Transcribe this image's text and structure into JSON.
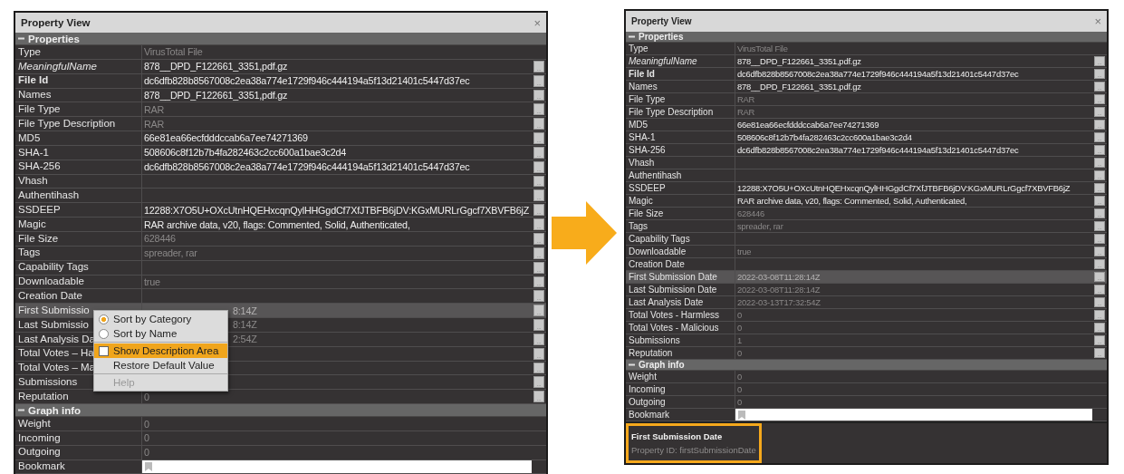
{
  "more_button": "...",
  "panels": [
    {
      "title": "Property View",
      "close": "×",
      "sections": [
        {
          "title": "Properties",
          "expanded": true,
          "rows": [
            {
              "label": "Type",
              "value": "VirusTotal File",
              "kind": "plain",
              "dim": true,
              "button": false,
              "selected": false
            },
            {
              "label": "MeaningfulName",
              "value": "878__DPD_F122661_3351,pdf.gz",
              "kind": "italic",
              "dim": false,
              "button": true,
              "selected": false
            },
            {
              "label": "File Id",
              "value": "dc6dfb828b8567008c2ea38a774e1729f946c444194a5f13d21401c5447d37ec",
              "kind": "bold",
              "dim": false,
              "button": true,
              "selected": false
            },
            {
              "label": "Names",
              "value": "878__DPD_F122661_3351,pdf.gz",
              "kind": "plain",
              "dim": false,
              "button": true,
              "selected": false
            },
            {
              "label": "File Type",
              "value": "RAR",
              "kind": "plain",
              "dim": true,
              "button": true,
              "selected": false
            },
            {
              "label": "File Type Description",
              "value": "RAR",
              "kind": "plain",
              "dim": true,
              "button": true,
              "selected": false
            },
            {
              "label": "MD5",
              "value": "66e81ea66ecfdddccab6a7ee74271369",
              "kind": "plain",
              "dim": false,
              "button": true,
              "selected": false
            },
            {
              "label": "SHA-1",
              "value": "508606c8f12b7b4fa282463c2cc600a1bae3c2d4",
              "kind": "plain",
              "dim": false,
              "button": true,
              "selected": false
            },
            {
              "label": "SHA-256",
              "value": "dc6dfb828b8567008c2ea38a774e1729f946c444194a5f13d21401c5447d37ec",
              "kind": "plain",
              "dim": false,
              "button": true,
              "selected": false
            },
            {
              "label": "Vhash",
              "kind": "plain",
              "button": true,
              "selected": false
            },
            {
              "label": "Authentihash",
              "kind": "plain",
              "button": true,
              "selected": false
            },
            {
              "label": "SSDEEP",
              "value": "12288:X7O5U+OXcUtnHQEHxcqnQylHHGgdCf7XfJTBFB6jDV:KGxMURLrGgcf7XBVFB6jZ",
              "kind": "plain",
              "dim": false,
              "button": true,
              "selected": false
            },
            {
              "label": "Magic",
              "value": "RAR archive data, v20, flags: Commented, Solid, Authenticated,",
              "kind": "plain",
              "dim": false,
              "button": true,
              "selected": false
            },
            {
              "label": "File Size",
              "value": "628446",
              "kind": "plain",
              "dim": true,
              "button": true,
              "selected": false
            },
            {
              "label": "Tags",
              "value": "spreader, rar",
              "kind": "plain",
              "dim": true,
              "button": true,
              "selected": false
            },
            {
              "label": "Capability Tags",
              "kind": "plain",
              "button": true,
              "selected": false
            },
            {
              "label": "Downloadable",
              "value": "true",
              "kind": "plain",
              "dim": true,
              "button": true,
              "selected": false
            },
            {
              "label": "Creation Date",
              "kind": "plain",
              "button": true,
              "selected": false
            },
            {
              "label": "First Submissio",
              "value": "8:14Z",
              "kind": "plain",
              "dim": true,
              "button": true,
              "selected": true,
              "covered": true
            },
            {
              "label": "Last Submissio",
              "value": "8:14Z",
              "kind": "plain",
              "dim": true,
              "button": true,
              "selected": false,
              "covered": true
            },
            {
              "label": "Last Analysis Da",
              "value": "2:54Z",
              "kind": "plain",
              "dim": true,
              "button": true,
              "selected": false,
              "covered": true
            },
            {
              "label": "Total Votes – Ha",
              "kind": "plain",
              "button": true,
              "selected": false
            },
            {
              "label": "Total Votes – Ma",
              "kind": "plain",
              "button": true,
              "selected": false
            },
            {
              "label": "Submissions",
              "kind": "plain",
              "button": true,
              "selected": false
            },
            {
              "label": "Reputation",
              "value": "0",
              "kind": "plain",
              "dim": true,
              "button": true,
              "selected": false
            }
          ]
        },
        {
          "title": "Graph info",
          "expanded": true,
          "rows": [
            {
              "label": "Weight",
              "value": "0",
              "kind": "plain",
              "dim": true,
              "button": false,
              "selected": false
            },
            {
              "label": "Incoming",
              "value": "0",
              "kind": "plain",
              "dim": true,
              "button": false,
              "selected": false
            },
            {
              "label": "Outgoing",
              "value": "0",
              "kind": "plain",
              "dim": true,
              "button": false,
              "selected": false
            },
            {
              "label": "Bookmark",
              "kind": "bookmark",
              "button": false,
              "selected": false
            }
          ]
        }
      ],
      "context_menu": {
        "items": [
          {
            "kind": "radio",
            "label": "Sort by Category",
            "checked": true,
            "highlighted": false,
            "disabled": false
          },
          {
            "kind": "radio",
            "label": "Sort by Name",
            "checked": false,
            "highlighted": false,
            "disabled": false
          },
          {
            "kind": "separator"
          },
          {
            "kind": "checkbox",
            "label": "Show Description Area",
            "checked": false,
            "highlighted": true,
            "disabled": false
          },
          {
            "kind": "plain",
            "label": "Restore Default Value",
            "highlighted": false,
            "disabled": false
          },
          {
            "kind": "separator"
          },
          {
            "kind": "plain",
            "label": "Help",
            "highlighted": false,
            "disabled": true
          }
        ]
      }
    },
    {
      "title": "Property View",
      "close": "×",
      "sections": [
        {
          "title": "Properties",
          "expanded": true,
          "rows": [
            {
              "label": "Type",
              "value": "VirusTotal File",
              "kind": "plain",
              "dim": true,
              "button": false,
              "selected": false
            },
            {
              "label": "MeaningfulName",
              "value": "878__DPD_F122661_3351,pdf.gz",
              "kind": "italic",
              "dim": false,
              "button": true,
              "selected": false
            },
            {
              "label": "File Id",
              "value": "dc6dfb828b8567008c2ea38a774e1729f946c444194a5f13d21401c5447d37ec",
              "kind": "bold",
              "dim": false,
              "button": true,
              "selected": false
            },
            {
              "label": "Names",
              "value": "878__DPD_F122661_3351,pdf.gz",
              "kind": "plain",
              "dim": false,
              "button": true,
              "selected": false
            },
            {
              "label": "File Type",
              "value": "RAR",
              "kind": "plain",
              "dim": true,
              "button": true,
              "selected": false
            },
            {
              "label": "File Type Description",
              "value": "RAR",
              "kind": "plain",
              "dim": true,
              "button": true,
              "selected": false
            },
            {
              "label": "MD5",
              "value": "66e81ea66ecfdddccab6a7ee74271369",
              "kind": "plain",
              "dim": false,
              "button": true,
              "selected": false
            },
            {
              "label": "SHA-1",
              "value": "508606c8f12b7b4fa282463c2cc600a1bae3c2d4",
              "kind": "plain",
              "dim": false,
              "button": true,
              "selected": false
            },
            {
              "label": "SHA-256",
              "value": "dc6dfb828b8567008c2ea38a774e1729f946c444194a5f13d21401c5447d37ec",
              "kind": "plain",
              "dim": false,
              "button": true,
              "selected": false
            },
            {
              "label": "Vhash",
              "kind": "plain",
              "button": true,
              "selected": false
            },
            {
              "label": "Authentihash",
              "kind": "plain",
              "button": true,
              "selected": false
            },
            {
              "label": "SSDEEP",
              "value": "12288:X7O5U+OXcUtnHQEHxcqnQylHHGgdCf7XfJTBFB6jDV:KGxMURLrGgcf7XBVFB6jZ",
              "kind": "plain",
              "dim": false,
              "button": true,
              "selected": false
            },
            {
              "label": "Magic",
              "value": "RAR archive data, v20, flags: Commented, Solid, Authenticated,",
              "kind": "plain",
              "dim": false,
              "button": true,
              "selected": false
            },
            {
              "label": "File Size",
              "value": "628446",
              "kind": "plain",
              "dim": true,
              "button": true,
              "selected": false
            },
            {
              "label": "Tags",
              "value": "spreader, rar",
              "kind": "plain",
              "dim": true,
              "button": true,
              "selected": false
            },
            {
              "label": "Capability Tags",
              "kind": "plain",
              "button": true,
              "selected": false
            },
            {
              "label": "Downloadable",
              "value": "true",
              "kind": "plain",
              "dim": true,
              "button": true,
              "selected": false
            },
            {
              "label": "Creation Date",
              "kind": "plain",
              "button": true,
              "selected": false
            },
            {
              "label": "First Submission Date",
              "value": "2022-03-08T11:28:14Z",
              "kind": "plain",
              "dim": true,
              "button": true,
              "selected": true
            },
            {
              "label": "Last Submission Date",
              "value": "2022-03-08T11:28:14Z",
              "kind": "plain",
              "dim": true,
              "button": true,
              "selected": false
            },
            {
              "label": "Last Analysis Date",
              "value": "2022-03-13T17:32:54Z",
              "kind": "plain",
              "dim": true,
              "button": true,
              "selected": false
            },
            {
              "label": "Total Votes - Harmless",
              "value": "0",
              "kind": "plain",
              "dim": true,
              "button": true,
              "selected": false
            },
            {
              "label": "Total Votes - Malicious",
              "value": "0",
              "kind": "plain",
              "dim": true,
              "button": true,
              "selected": false
            },
            {
              "label": "Submissions",
              "value": "1",
              "kind": "plain",
              "dim": true,
              "button": true,
              "selected": false
            },
            {
              "label": "Reputation",
              "value": "0",
              "kind": "plain",
              "dim": true,
              "button": true,
              "selected": false
            }
          ]
        },
        {
          "title": "Graph info",
          "expanded": true,
          "rows": [
            {
              "label": "Weight",
              "value": "0",
              "kind": "plain",
              "dim": true,
              "button": false,
              "selected": false
            },
            {
              "label": "Incoming",
              "value": "0",
              "kind": "plain",
              "dim": true,
              "button": false,
              "selected": false
            },
            {
              "label": "Outgoing",
              "value": "0",
              "kind": "plain",
              "dim": true,
              "button": false,
              "selected": false
            },
            {
              "label": "Bookmark",
              "kind": "bookmark",
              "button": false,
              "selected": false
            }
          ]
        }
      ],
      "description": {
        "title": "First Submission Date",
        "text": "Property ID: firstSubmissionDate",
        "highlighted": true
      }
    }
  ]
}
